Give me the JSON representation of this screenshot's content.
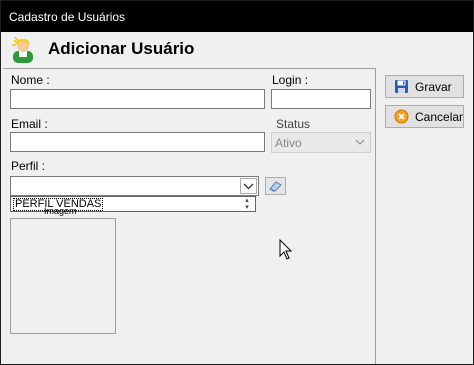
{
  "window": {
    "title": "Cadastro de Usuários"
  },
  "header": {
    "title": "Adicionar Usuário",
    "icon": "user-icon"
  },
  "form": {
    "nome_label": "Nome :",
    "nome_value": "",
    "login_label": "Login :",
    "login_value": "",
    "email_label": "Email :",
    "email_value": "",
    "status_label": "Status",
    "status_value": "Ativo",
    "perfil_label": "Perfil :",
    "perfil_value": "",
    "perfil_dropdown_item": "PERFIL VENDAS",
    "image_label": "Imagem"
  },
  "buttons": {
    "gravar_label": "Gravar",
    "cancelar_label": "Cancelar",
    "gravar_icon": "floppy-disk-icon",
    "cancelar_icon": "cancel-icon",
    "clear_icon": "eraser-icon"
  },
  "colors": {
    "titlebar": "#000000",
    "window_bg": "#f0f0f0",
    "disabled_field": "#e9e9e9"
  }
}
